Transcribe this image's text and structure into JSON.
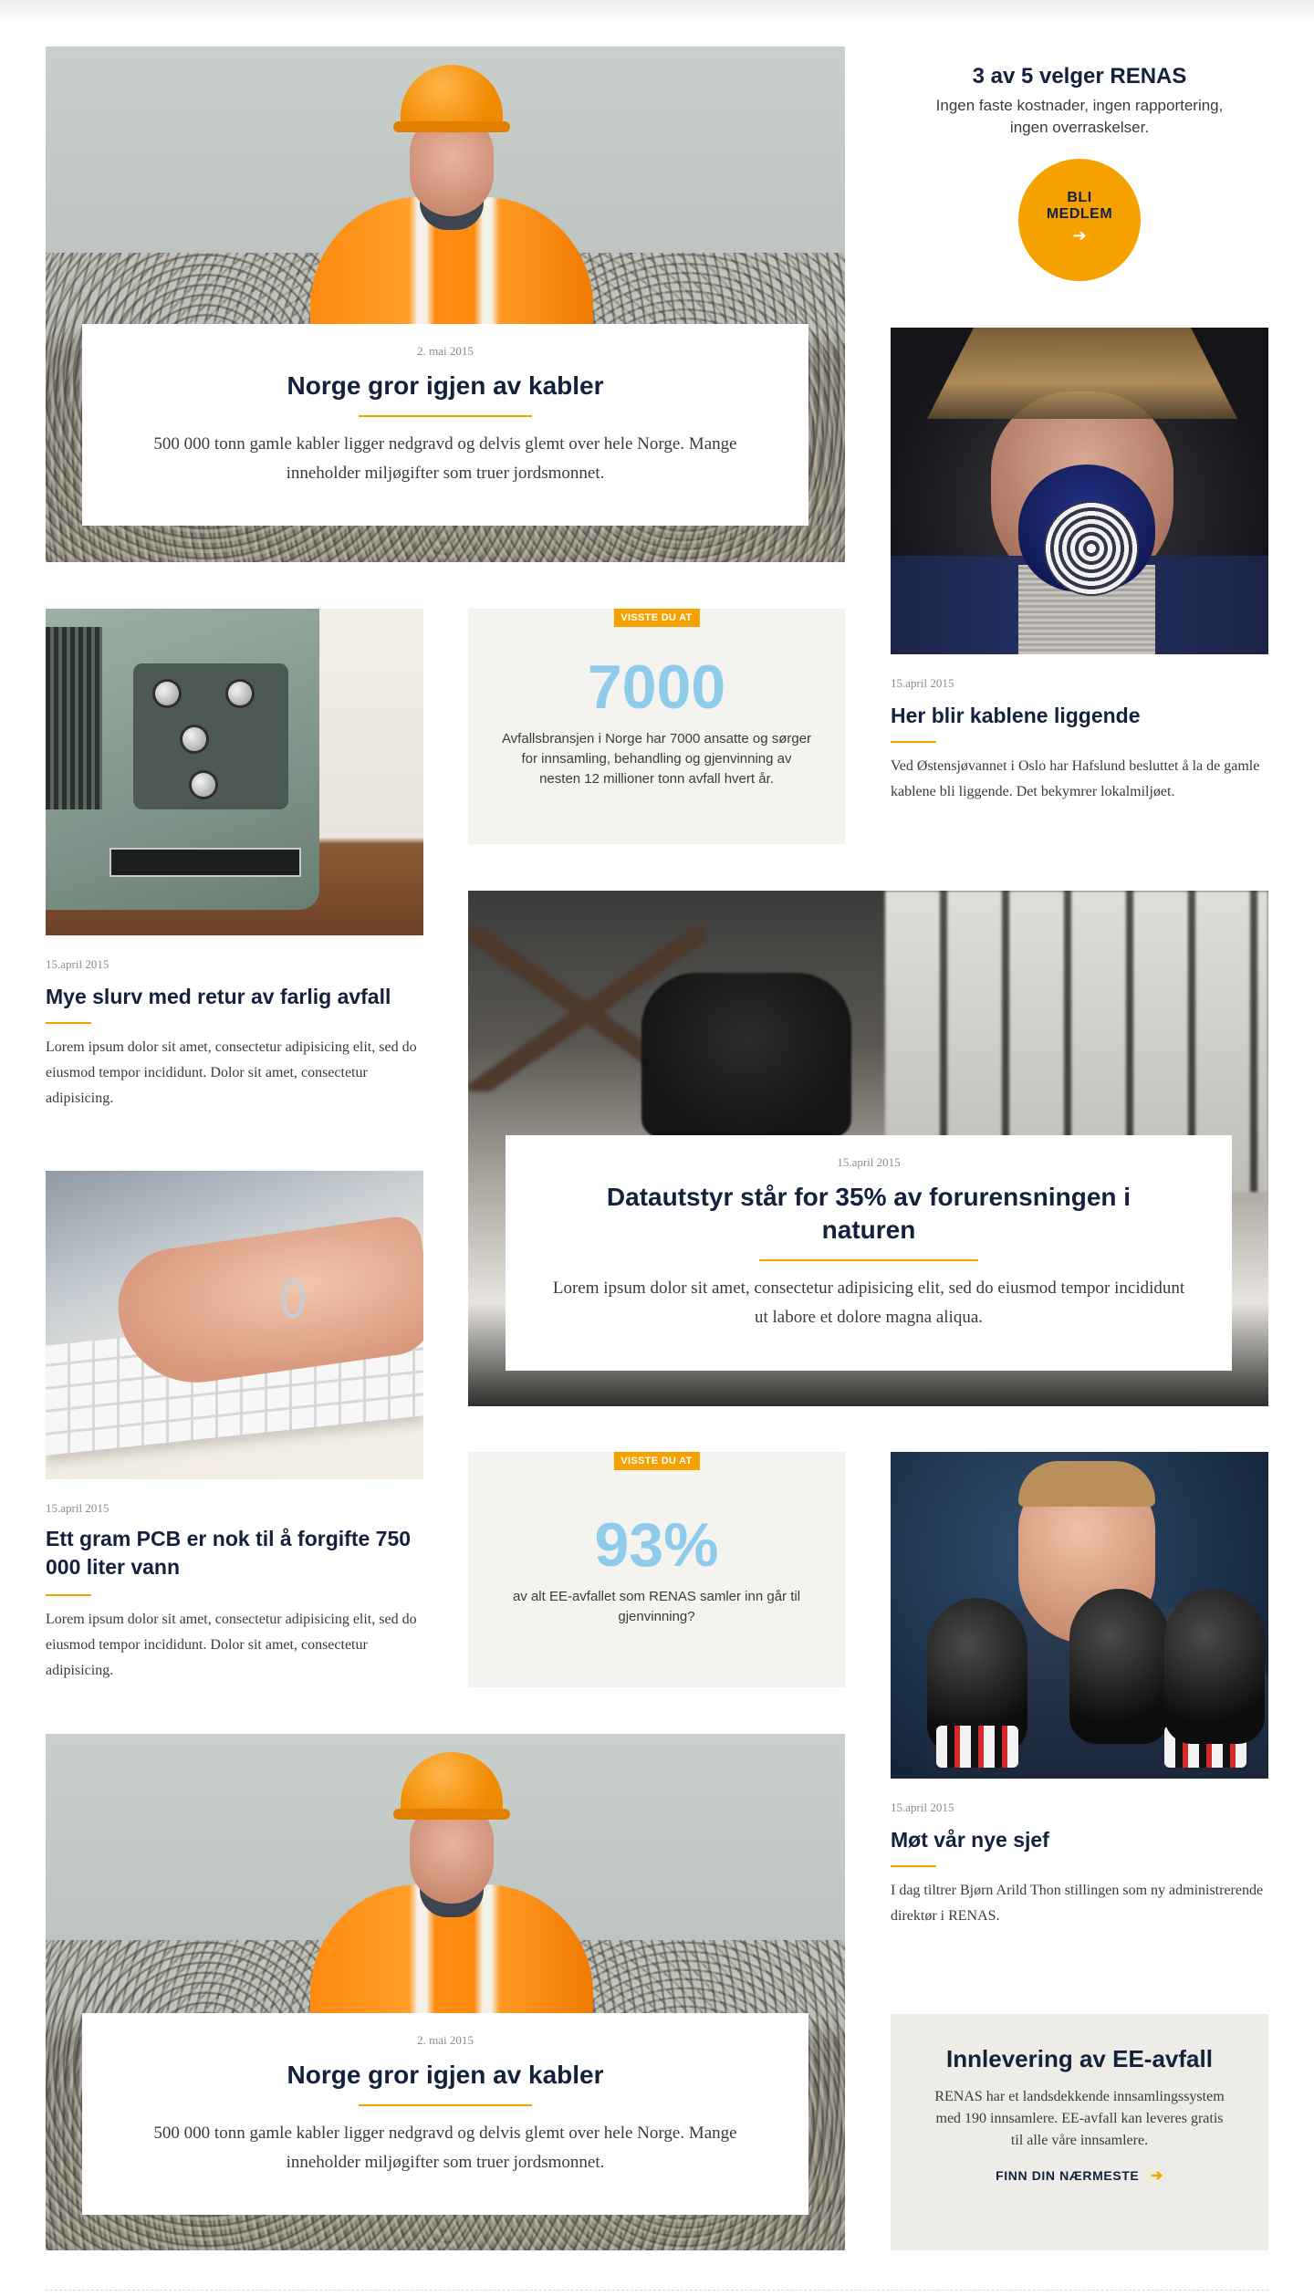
{
  "cta": {
    "heading": "3 av 5 velger RENAS",
    "text": "Ingen faste kostnader, ingen rapportering, ingen overraskelser.",
    "button_line1": "BLI",
    "button_line2": "MEDLEM",
    "button_arrow": "➔"
  },
  "feature_top": {
    "date": "2. mai 2015",
    "title": "Norge gror igjen av kabler",
    "text": "500 000 tonn gamle kabler ligger nedgravd og delvis glemt over hele Norge. Mange inneholder miljøgifter som truer jordsmonnet."
  },
  "fact_1": {
    "tag": "VISSTE DU AT",
    "number": "7000",
    "text": "Avfallsbransjen i Norge har 7000 ansatte og sørger for innsamling, behandling og gjenvinning av nesten 12 millioner tonn avfall hvert år."
  },
  "article_cables": {
    "date": "15.april 2015",
    "title": "Her blir kablene liggende",
    "text": "Ved Østensjøvannet i Oslo har Hafslund besluttet å la de gamle kablene bli liggende. Det bekymrer lokalmiljøet."
  },
  "article_waste": {
    "date": "15.april 2015",
    "title": "Mye slurv med retur av farlig avfall",
    "text": "Lorem ipsum dolor sit amet, consectetur adipisicing elit, sed do eiusmod tempor incididunt. Dolor sit amet, consectetur adipisicing."
  },
  "feature_office": {
    "date": "15.april 2015",
    "title": "Datautstyr står for 35% av forurensningen i naturen",
    "text": "Lorem ipsum dolor sit amet, consectetur adipisicing elit, sed do eiusmod tempor incididunt ut labore et dolore magna aliqua."
  },
  "article_pcb": {
    "date": "15.april 2015",
    "title": "Ett gram PCB er nok til å forgifte 750 000 liter vann",
    "text": "Lorem ipsum dolor sit amet, consectetur adipisicing elit, sed do eiusmod tempor incididunt. Dolor sit amet, consectetur adipisicing."
  },
  "fact_2": {
    "tag": "VISSTE DU AT",
    "number": "93%",
    "text": "av alt EE-avfallet som RENAS samler inn går til gjenvinning?"
  },
  "article_boss": {
    "date": "15.april 2015",
    "title": "Møt vår nye sjef",
    "text": "I dag tiltrer Bjørn Arild Thon stillingen som ny administrerende direktør i RENAS."
  },
  "feature_bottom": {
    "date": "2. mai 2015",
    "title": "Norge gror igjen av kabler",
    "text": "500 000 tonn gamle kabler ligger nedgravd og delvis glemt over hele Norge. Mange inneholder miljøgifter som truer jordsmonnet."
  },
  "info_box": {
    "title": "Innlevering av EE-avfall",
    "text": "RENAS har et landsdekkende innsamlingssystem med 190 innsamlere. EE-avfall kan leveres gratis til alle våre innsamlere.",
    "link": "FINN DIN NÆRMESTE",
    "link_arrow": "➔"
  },
  "colors": {
    "accent": "#f5a200",
    "navy": "#14213d",
    "fact_number": "#8fcbea",
    "fact_bg": "#f4f3ef"
  }
}
